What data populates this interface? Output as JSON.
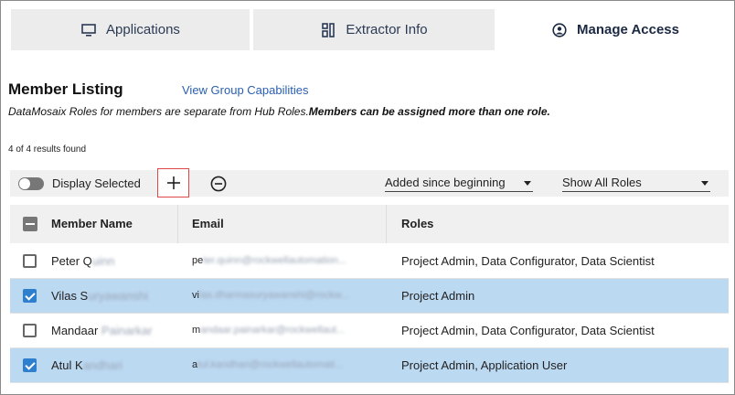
{
  "tabs": [
    {
      "label": "Applications",
      "icon": "monitor-icon"
    },
    {
      "label": "Extractor Info",
      "icon": "extractor-icon"
    },
    {
      "label": "Manage Access",
      "icon": "user-circle-icon",
      "active": true
    }
  ],
  "header": {
    "title": "Member Listing",
    "group_link": "View Group Capabilities",
    "subtitle_italic": "DataMosaix Roles for members are separate from Hub Roles.",
    "subtitle_bold": "Members can be assigned more than one role.",
    "result_count": "4 of 4 results found"
  },
  "toolbar": {
    "toggle_label": "Display Selected",
    "toggle_on": false,
    "add_icon": "plus-icon",
    "remove_icon": "minus-circle-icon",
    "date_filter": "Added since beginning",
    "role_filter": "Show All Roles"
  },
  "table": {
    "columns": [
      "Member Name",
      "Email",
      "Roles"
    ],
    "rows": [
      {
        "selected": false,
        "name_visible": "Peter Q",
        "name_blurred": "uinn",
        "email_visible": "pe",
        "email_blurred": "ter.quinn@rockwellautomation...",
        "roles": "Project Admin, Data Configurator, Data Scientist"
      },
      {
        "selected": true,
        "name_visible": "Vilas S",
        "name_blurred": "uryawanshi",
        "email_visible": "vi",
        "email_blurred": "las.dharmasuryawanshi@rockw...",
        "roles": "Project Admin"
      },
      {
        "selected": false,
        "name_visible": "Mandaar ",
        "name_blurred": "Painarkar",
        "email_visible": "m",
        "email_blurred": "andaar.painarkar@rockwellaut...",
        "roles": "Project Admin, Data Configurator, Data Scientist"
      },
      {
        "selected": true,
        "name_visible": "Atul K",
        "name_blurred": "andhari",
        "email_visible": "a",
        "email_blurred": "tul.kandhari@rockwellautomati...",
        "roles": "Project Admin, Application User"
      }
    ]
  },
  "colors": {
    "selected_row": "#bcd9f2",
    "checkbox_checked": "#2f7fcf",
    "link": "#2a5fb0",
    "add_button_border": "#e04848"
  }
}
